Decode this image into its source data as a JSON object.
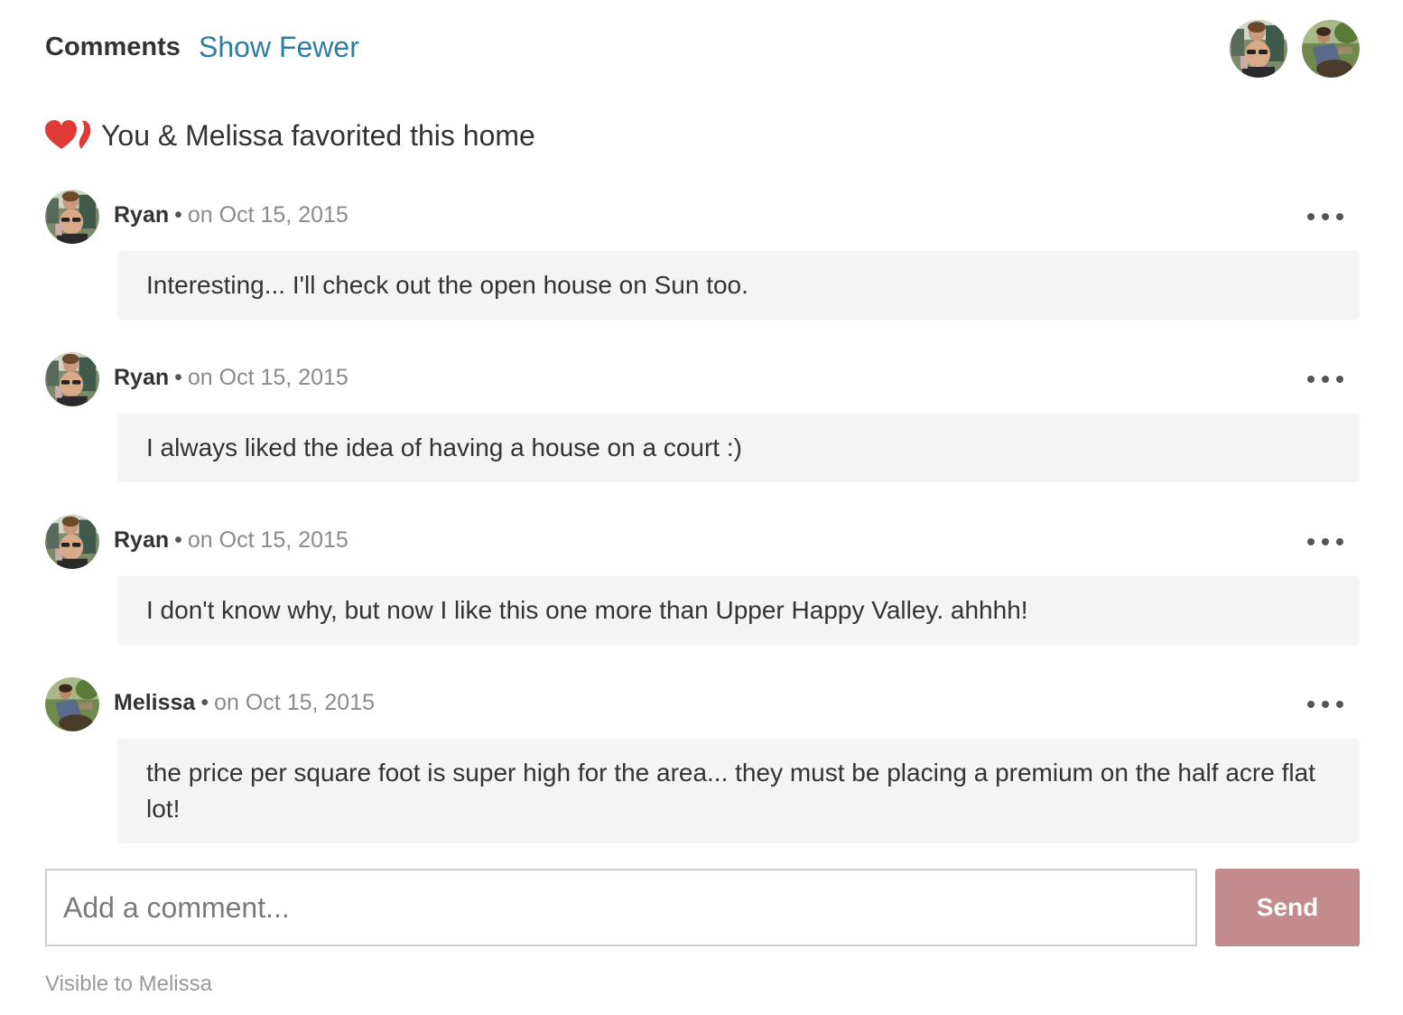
{
  "header": {
    "title": "Comments",
    "toggle_label": "Show Fewer",
    "participants": [
      "Ryan",
      "Melissa"
    ]
  },
  "favorite": {
    "icon": "hearts-icon",
    "text": "You & Melissa favorited this home",
    "color": "#e03a36"
  },
  "comments": [
    {
      "author": "Ryan",
      "separator": "•",
      "date": "on Oct 15, 2015",
      "text": "Interesting... I'll check out the open house on Sun too."
    },
    {
      "author": "Ryan",
      "separator": "•",
      "date": "on Oct 15, 2015",
      "text": "I always liked the idea of having a house on a court :)"
    },
    {
      "author": "Ryan",
      "separator": "•",
      "date": "on Oct 15, 2015",
      "text": "I don't know why, but now I like this one more than Upper Happy Valley. ahhhh!"
    },
    {
      "author": "Melissa",
      "separator": "•",
      "date": "on Oct 15, 2015",
      "text": "the price per square foot is super high for the area... they must be placing a premium on the half acre flat lot!"
    }
  ],
  "composer": {
    "placeholder": "Add a comment...",
    "value": "",
    "send_label": "Send",
    "send_color": "#c38b8b"
  },
  "visibility_note": "Visible to Melissa",
  "colors": {
    "link": "#2f7ea1",
    "bubble": "#f4f4f4",
    "muted": "#8a8a8a"
  }
}
